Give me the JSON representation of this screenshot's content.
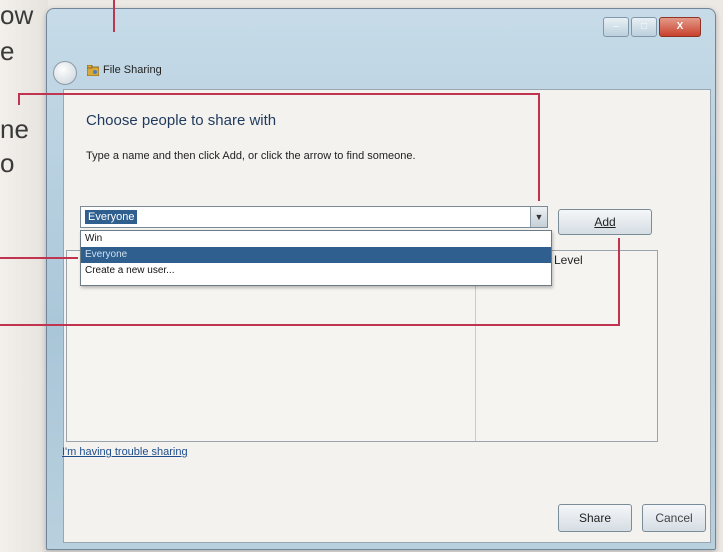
{
  "page_edge": {
    "fragments": [
      "ow",
      "e",
      "ne",
      "o"
    ]
  },
  "window": {
    "title": "File Sharing",
    "controls": {
      "minimize": "–",
      "maximize": "□",
      "close": "X"
    }
  },
  "content": {
    "heading": "Choose people to share with",
    "instruction": "Type a name and then click Add, or click the arrow to find someone.",
    "combo_value": "Everyone",
    "add_label": "Add",
    "level_header": "Level",
    "dropdown_options": [
      "Win",
      "Everyone",
      "Create a new user..."
    ],
    "trouble_link": "I'm having trouble sharing",
    "share_label": "Share",
    "cancel_label": "Cancel"
  },
  "colors": {
    "callout": "#c0344f",
    "selection": "#2f5f8f",
    "link": "#1f4e8c"
  }
}
